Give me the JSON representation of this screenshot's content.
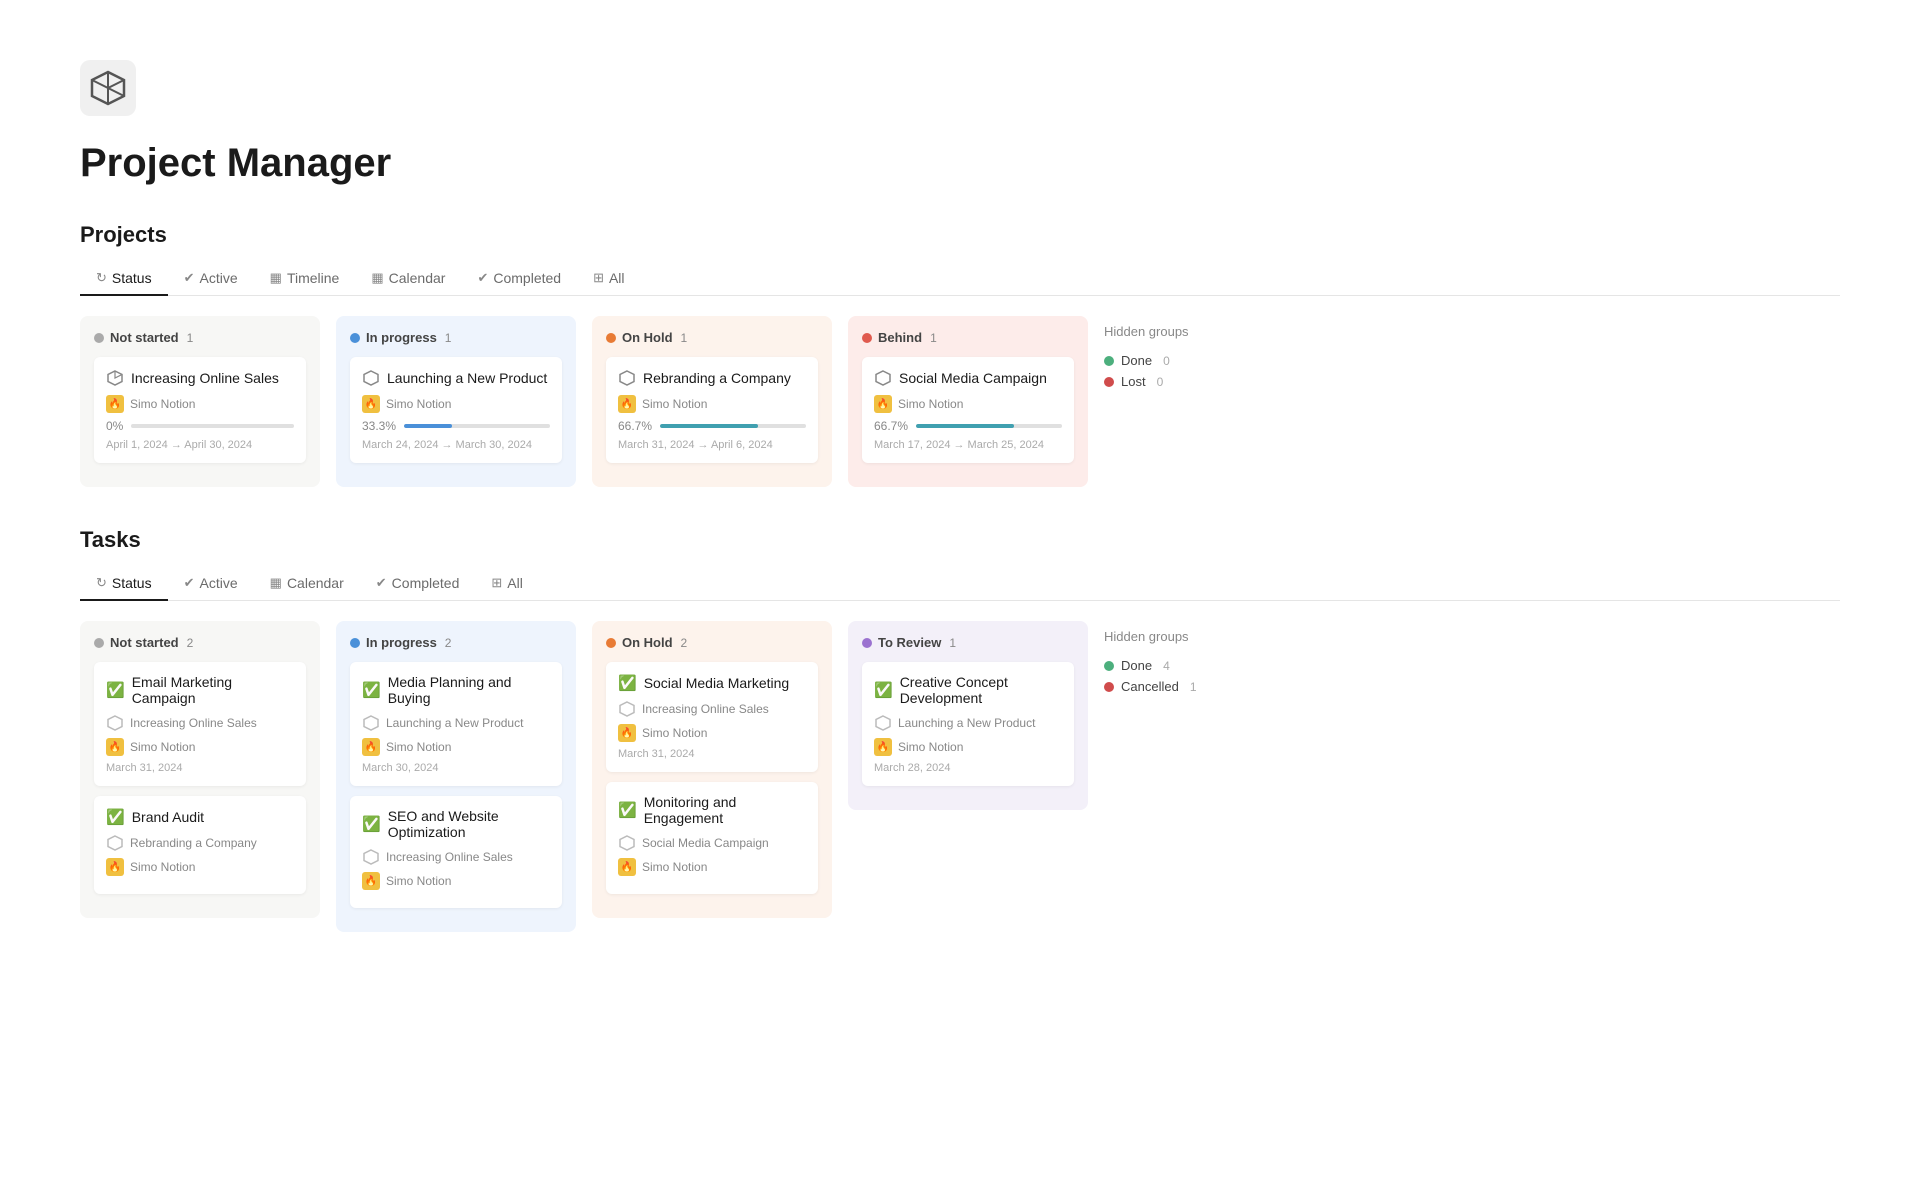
{
  "app": {
    "title": "Project Manager"
  },
  "projects_section": {
    "heading": "Projects",
    "tabs": [
      {
        "label": "Status",
        "icon": "↻",
        "active": true
      },
      {
        "label": "Active",
        "icon": "✔"
      },
      {
        "label": "Timeline",
        "icon": "▦"
      },
      {
        "label": "Calendar",
        "icon": "▦"
      },
      {
        "label": "Completed",
        "icon": "✔"
      },
      {
        "label": "All",
        "icon": "⊞"
      }
    ],
    "columns": [
      {
        "id": "not-started",
        "label": "Not started",
        "count": 1,
        "dot": "gray",
        "bg": "default",
        "cards": [
          {
            "title": "Increasing Online Sales",
            "author": "Simo Notion",
            "progress_pct": "0%",
            "progress_val": 0,
            "date": "April 1, 2024 → April 30, 2024"
          }
        ]
      },
      {
        "id": "in-progress",
        "label": "In progress",
        "count": 1,
        "dot": "blue",
        "bg": "inprogress",
        "cards": [
          {
            "title": "Launching a New Product",
            "author": "Simo Notion",
            "progress_pct": "33.3%",
            "progress_val": 33,
            "date": "March 24, 2024 → March 30, 2024"
          }
        ]
      },
      {
        "id": "on-hold",
        "label": "On Hold",
        "count": 1,
        "dot": "orange",
        "bg": "onhold",
        "cards": [
          {
            "title": "Rebranding a Company",
            "author": "Simo Notion",
            "progress_pct": "66.7%",
            "progress_val": 67,
            "date": "March 31, 2024 → April 6, 2024"
          }
        ]
      },
      {
        "id": "behind",
        "label": "Behind",
        "count": 1,
        "dot": "red",
        "bg": "behind",
        "cards": [
          {
            "title": "Social Media Campaign",
            "author": "Simo Notion",
            "progress_pct": "66.7%",
            "progress_val": 67,
            "date": "March 17, 2024 → March 25, 2024"
          }
        ]
      }
    ],
    "hidden_groups": {
      "label": "Hidden groups",
      "items": [
        {
          "label": "Done",
          "dot": "green",
          "count": "0"
        },
        {
          "label": "Lost",
          "dot": "darkred",
          "count": "0"
        }
      ]
    }
  },
  "tasks_section": {
    "heading": "Tasks",
    "tabs": [
      {
        "label": "Status",
        "icon": "↻",
        "active": true
      },
      {
        "label": "Active",
        "icon": "✔"
      },
      {
        "label": "Calendar",
        "icon": "▦"
      },
      {
        "label": "Completed",
        "icon": "✔"
      },
      {
        "label": "All",
        "icon": "⊞"
      }
    ],
    "columns": [
      {
        "id": "not-started",
        "label": "Not started",
        "count": 2,
        "dot": "gray",
        "bg": "default",
        "cards": [
          {
            "title": "Email Marketing Campaign",
            "project": "Increasing Online Sales",
            "author": "Simo Notion",
            "date": "March 31, 2024"
          },
          {
            "title": "Brand Audit",
            "project": "Rebranding a Company",
            "author": "Simo Notion",
            "date": ""
          }
        ]
      },
      {
        "id": "in-progress",
        "label": "In progress",
        "count": 2,
        "dot": "blue",
        "bg": "inprogress",
        "cards": [
          {
            "title": "Media Planning and Buying",
            "project": "Launching a New Product",
            "author": "Simo Notion",
            "date": "March 30, 2024"
          },
          {
            "title": "SEO and Website Optimization",
            "project": "Increasing Online Sales",
            "author": "Simo Notion",
            "date": ""
          }
        ]
      },
      {
        "id": "on-hold",
        "label": "On Hold",
        "count": 2,
        "dot": "orange",
        "bg": "onhold",
        "cards": [
          {
            "title": "Social Media Marketing",
            "project": "Increasing Online Sales",
            "author": "Simo Notion",
            "date": "March 31, 2024"
          },
          {
            "title": "Monitoring and Engagement",
            "project": "Social Media Campaign",
            "author": "Simo Notion",
            "date": ""
          }
        ]
      },
      {
        "id": "to-review",
        "label": "To Review",
        "count": 1,
        "dot": "purple",
        "bg": "toreview",
        "cards": [
          {
            "title": "Creative Concept Development",
            "project": "Launching a New Product",
            "author": "Simo Notion",
            "date": "March 28, 2024"
          }
        ]
      }
    ],
    "hidden_groups": {
      "label": "Hidden groups",
      "items": [
        {
          "label": "Done",
          "dot": "green",
          "count": "4"
        },
        {
          "label": "Cancelled",
          "dot": "darkred",
          "count": "1"
        }
      ]
    }
  }
}
